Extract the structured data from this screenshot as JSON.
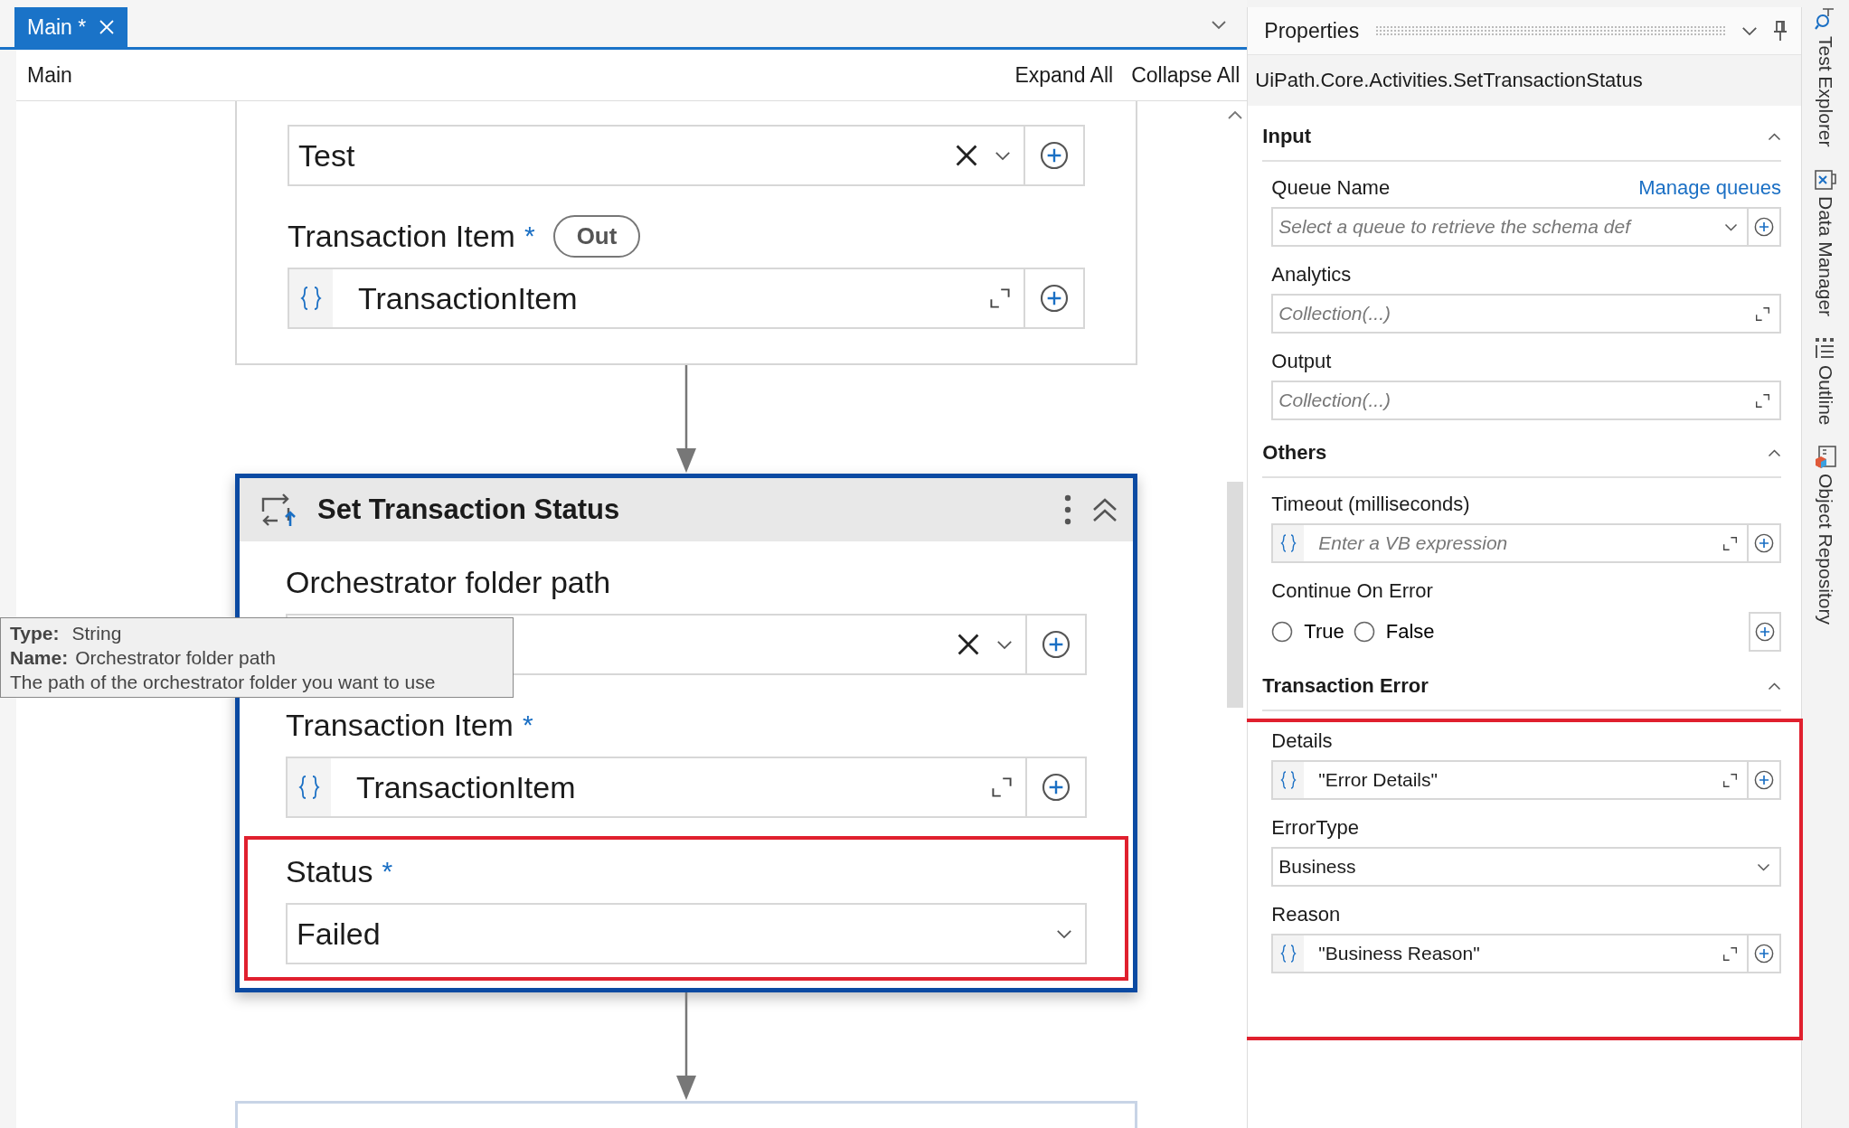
{
  "tabs": [
    {
      "label": "Main *",
      "selected": true
    }
  ],
  "breadcrumb": "Main",
  "toolbar": [
    "Expand All",
    "Collapse All"
  ],
  "canvas": {
    "top_card": {
      "fields": [
        {
          "kind": "combo",
          "value": "Test",
          "clearable": true
        },
        {
          "kind": "expression",
          "label": "Transaction Item",
          "required_mark": "*",
          "badge": "Out",
          "value": "TransactionItem"
        }
      ]
    },
    "activity": {
      "title": "Set Transaction Status",
      "selected": true,
      "fields": [
        {
          "kind": "combo",
          "label": "Orchestrator folder path",
          "clearable": true
        },
        {
          "kind": "expression",
          "label": "Transaction Item",
          "required_mark": "*",
          "value": "TransactionItem"
        },
        {
          "kind": "dropdown",
          "label": "Status",
          "required_mark": "*",
          "value": "Failed",
          "highlighted": true
        }
      ]
    },
    "tooltip": {
      "type_label": "Type:",
      "type": "String",
      "name_label": "Name:",
      "name": "Orchestrator folder path",
      "description": "The path of the orchestrator folder you want to use"
    }
  },
  "properties": {
    "title": "Properties",
    "type_name": "UiPath.Core.Activities.SetTransactionStatus",
    "sections": [
      {
        "title": "Input",
        "expanded": true,
        "highlighted": false,
        "fields": [
          {
            "kind": "combo",
            "label": "Queue Name",
            "link": "Manage queues",
            "placeholder": "Select a queue to retrieve the schema def"
          },
          {
            "kind": "collection",
            "label": "Analytics",
            "placeholder": "Collection(...)"
          },
          {
            "kind": "collection",
            "label": "Output",
            "placeholder": "Collection(...)"
          }
        ]
      },
      {
        "title": "Others",
        "expanded": true,
        "highlighted": false,
        "fields": [
          {
            "kind": "expression",
            "label": "Timeout (milliseconds)",
            "placeholder": "Enter a VB expression"
          },
          {
            "kind": "radio",
            "label": "Continue On Error",
            "options": [
              {
                "label": "True",
                "selected": false
              },
              {
                "label": "False",
                "selected": false
              }
            ]
          }
        ]
      },
      {
        "title": "Transaction Error",
        "expanded": true,
        "highlighted": true,
        "fields": [
          {
            "kind": "expression",
            "label": "Details",
            "value": "\"Error Details\""
          },
          {
            "kind": "dropdown",
            "label": "ErrorType",
            "value": "Business"
          },
          {
            "kind": "expression",
            "label": "Reason",
            "value": "\"Business Reason\""
          }
        ]
      }
    ]
  },
  "side_tabs": [
    {
      "kind": "test",
      "label": "Test Explorer"
    },
    {
      "kind": "data",
      "label": "Data Manager"
    },
    {
      "kind": "outline",
      "label": "Outline"
    },
    {
      "kind": "repo",
      "label": "Object Repository"
    }
  ]
}
